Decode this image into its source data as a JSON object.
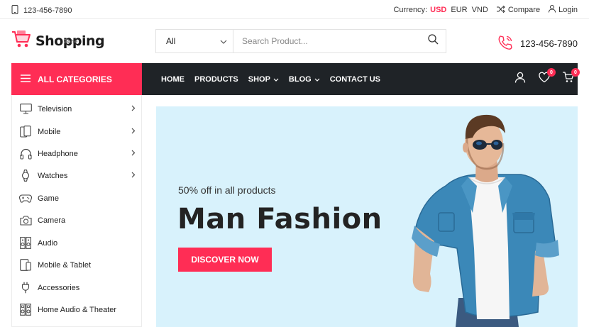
{
  "topbar": {
    "phone": "123-456-7890",
    "currency_label": "Currency:",
    "currencies": [
      "USD",
      "EUR",
      "VND"
    ],
    "active_currency": "USD",
    "compare": "Compare",
    "login": "Login"
  },
  "header": {
    "logo_text": "Shopping",
    "logo_sub": "Zone",
    "search_category": "All",
    "search_placeholder": "Search Product...",
    "phone": "123-456-7890"
  },
  "nav": {
    "all_categories": "ALL CATEGORIES",
    "items": [
      {
        "label": "HOME",
        "dropdown": false
      },
      {
        "label": "PRODUCTS",
        "dropdown": false
      },
      {
        "label": "SHOP",
        "dropdown": true
      },
      {
        "label": "BLOG",
        "dropdown": true
      },
      {
        "label": "CONTACT US",
        "dropdown": false
      }
    ],
    "wishlist_count": "0",
    "cart_count": "0"
  },
  "sidebar": {
    "items": [
      {
        "label": "Television",
        "icon": "tv-icon",
        "has_sub": true
      },
      {
        "label": "Mobile",
        "icon": "mobile-icon",
        "has_sub": true
      },
      {
        "label": "Headphone",
        "icon": "headphone-icon",
        "has_sub": true
      },
      {
        "label": "Watches",
        "icon": "watch-icon",
        "has_sub": true
      },
      {
        "label": "Game",
        "icon": "gamepad-icon",
        "has_sub": false
      },
      {
        "label": "Camera",
        "icon": "camera-icon",
        "has_sub": false
      },
      {
        "label": "Audio",
        "icon": "speaker-icon",
        "has_sub": false
      },
      {
        "label": "Mobile & Tablet",
        "icon": "tablet-icon",
        "has_sub": false
      },
      {
        "label": "Accessories",
        "icon": "plug-icon",
        "has_sub": false
      },
      {
        "label": "Home Audio & Theater",
        "icon": "home-audio-icon",
        "has_sub": false
      }
    ]
  },
  "hero": {
    "subtitle": "50% off in all products",
    "title": "Man Fashion",
    "button": "DISCOVER NOW"
  },
  "colors": {
    "accent": "#ff2d55",
    "nav_bg": "#1f2327",
    "hero_bg": "#d8f2fc"
  }
}
